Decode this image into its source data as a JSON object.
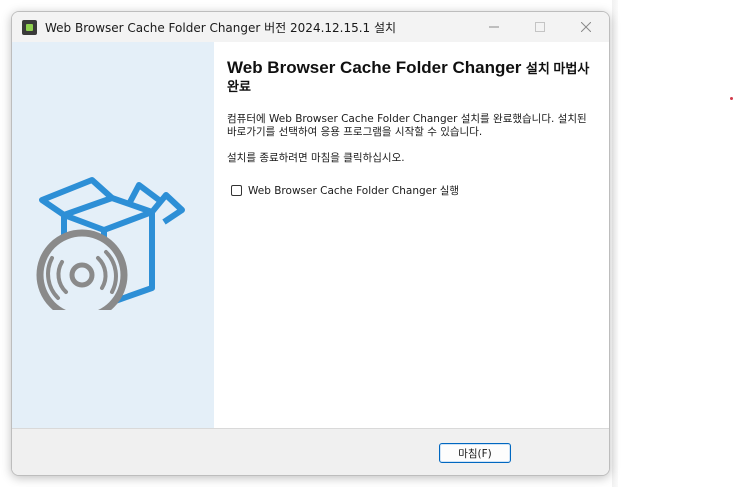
{
  "window": {
    "title": "Web Browser Cache Folder Changer 버전 2024.12.15.1 설치",
    "app_icon": "installer-app-icon",
    "controls": {
      "minimize_icon": "minimize-icon",
      "maximize_icon": "maximize-icon",
      "close_icon": "close-icon"
    }
  },
  "sidebar": {
    "illustration": "software-box-with-disc"
  },
  "content": {
    "heading_main": "Web Browser Cache Folder Changer",
    "heading_tail": "설치 마법사 완료",
    "paragraph1": "컴퓨터에 Web Browser Cache Folder Changer 설치를 완료했습니다. 설치된 바로가기를 선택하여 응용 프로그램을 시작할 수 있습니다.",
    "paragraph2": "설치를 종료하려면 마침을 클릭하십시오.",
    "run_checkbox": {
      "label": "Web Browser Cache Folder Changer 실행",
      "checked": false
    }
  },
  "footer": {
    "finish_label": "마침(F)"
  },
  "colors": {
    "sidebar_bg": "#e4eff8",
    "accent": "#0067c0",
    "box_blue": "#2d8fd6",
    "disc_gray": "#8a8a8a"
  }
}
